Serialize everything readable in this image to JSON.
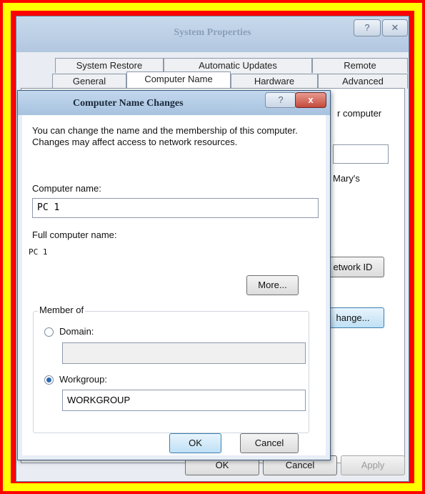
{
  "bg_window": {
    "title": "System Properties",
    "help_icon": "?",
    "close_icon": "✕",
    "tabs_row1": [
      "System Restore",
      "Automatic Updates",
      "Remote"
    ],
    "tabs_row2": [
      "General",
      "Computer Name",
      "Hardware",
      "Advanced"
    ],
    "peek_text_1": "r computer",
    "peek_text_2": "Mary's",
    "network_id_button": "etwork ID",
    "change_button": "hange...",
    "ok_button": "OK",
    "cancel_button": "Cancel",
    "apply_button": "Apply"
  },
  "dialog": {
    "title": "Computer Name Changes",
    "help_icon": "?",
    "close_icon": "x",
    "description": "You can change the name and the membership of this computer. Changes may affect access to network resources.",
    "computer_name_label": "Computer name:",
    "computer_name_value": "PC 1",
    "full_name_label": "Full computer name:",
    "full_name_value": "PC 1",
    "more_button": "More...",
    "member_of_label": "Member of",
    "domain_label": "Domain:",
    "domain_value": "",
    "domain_selected": false,
    "workgroup_label": "Workgroup:",
    "workgroup_value": "WORKGROUP",
    "workgroup_selected": true,
    "ok_button": "OK",
    "cancel_button": "Cancel"
  },
  "colors": {
    "outer_border": "#ff0000",
    "inner_border": "#ffff00",
    "radio_selected": "#2a6ab0"
  }
}
